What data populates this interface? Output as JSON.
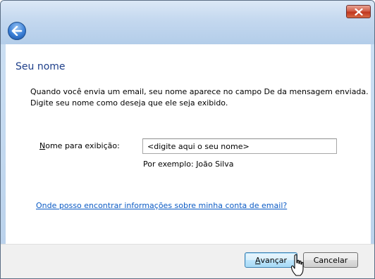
{
  "window": {
    "close_icon": "close-icon",
    "back_icon": "back-arrow-icon"
  },
  "page": {
    "heading": "Seu nome",
    "description_line1": "Quando você envia um email, seu nome aparece no campo De da mensagem enviada.",
    "description_line2": "Digite seu nome como deseja que ele seja exibido."
  },
  "form": {
    "name_label_accel": "N",
    "name_label_rest": "ome para exibição:",
    "name_value": "<digite aqui o seu nome>",
    "example": "Por exemplo: João Silva"
  },
  "help_link": "Onde posso encontrar informações sobre minha conta de email?",
  "buttons": {
    "next_accel": "A",
    "next_rest": "vançar",
    "cancel": "Cancelar"
  },
  "cursor_icon": "hand-pointer-icon"
}
